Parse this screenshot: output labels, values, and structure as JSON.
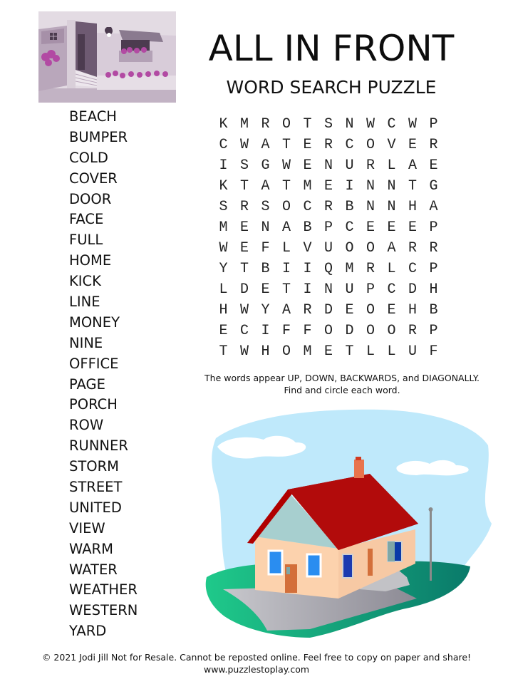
{
  "header": {
    "title": "ALL IN FRONT",
    "subtitle": "WORD SEARCH PUZZLE"
  },
  "images": {
    "top": "house-front-porch-illustration",
    "bottom": "house-with-red-roof-illustration"
  },
  "word_list": [
    "BEACH",
    "BUMPER",
    "COLD",
    "COVER",
    "DOOR",
    "FACE",
    "FULL",
    "HOME",
    "KICK",
    "LINE",
    "MONEY",
    "NINE",
    "OFFICE",
    "PAGE",
    "PORCH",
    "ROW",
    "RUNNER",
    "STORM",
    "STREET",
    "UNITED",
    "VIEW",
    "WARM",
    "WATER",
    "WEATHER",
    "WESTERN",
    "YARD"
  ],
  "grid": [
    [
      "K",
      "M",
      "R",
      "O",
      "T",
      "S",
      "N",
      "W",
      "C",
      "W",
      "P"
    ],
    [
      "C",
      "W",
      "A",
      "T",
      "E",
      "R",
      "C",
      "O",
      "V",
      "E",
      "R"
    ],
    [
      "I",
      "S",
      "G",
      "W",
      "E",
      "N",
      "U",
      "R",
      "L",
      "A",
      "E"
    ],
    [
      "K",
      "T",
      "A",
      "T",
      "M",
      "E",
      "I",
      "N",
      "N",
      "T",
      "G"
    ],
    [
      "S",
      "R",
      "S",
      "O",
      "C",
      "R",
      "B",
      "N",
      "N",
      "H",
      "A"
    ],
    [
      "M",
      "E",
      "N",
      "A",
      "B",
      "P",
      "C",
      "E",
      "E",
      "E",
      "P"
    ],
    [
      "W",
      "E",
      "F",
      "L",
      "V",
      "U",
      "O",
      "O",
      "A",
      "R",
      "R"
    ],
    [
      "Y",
      "T",
      "B",
      "I",
      "I",
      "Q",
      "M",
      "R",
      "L",
      "C",
      "P"
    ],
    [
      "L",
      "D",
      "E",
      "T",
      "I",
      "N",
      "U",
      "P",
      "C",
      "D",
      "H"
    ],
    [
      "H",
      "W",
      "Y",
      "A",
      "R",
      "D",
      "E",
      "O",
      "E",
      "H",
      "B"
    ],
    [
      "E",
      "C",
      "I",
      "F",
      "F",
      "O",
      "D",
      "O",
      "O",
      "R",
      "P"
    ],
    [
      "T",
      "W",
      "H",
      "O",
      "M",
      "E",
      "T",
      "L",
      "L",
      "U",
      "F"
    ]
  ],
  "instructions": {
    "line1": "The words appear UP, DOWN, BACKWARDS, and DIAGONALLY.",
    "line2": "Find and circle each word."
  },
  "footer": {
    "copyright": "© 2021  Jodi Jill Not for Resale. Cannot be reposted online. Feel free to copy on paper and share!",
    "website": "www.puzzlestoplay.com"
  }
}
